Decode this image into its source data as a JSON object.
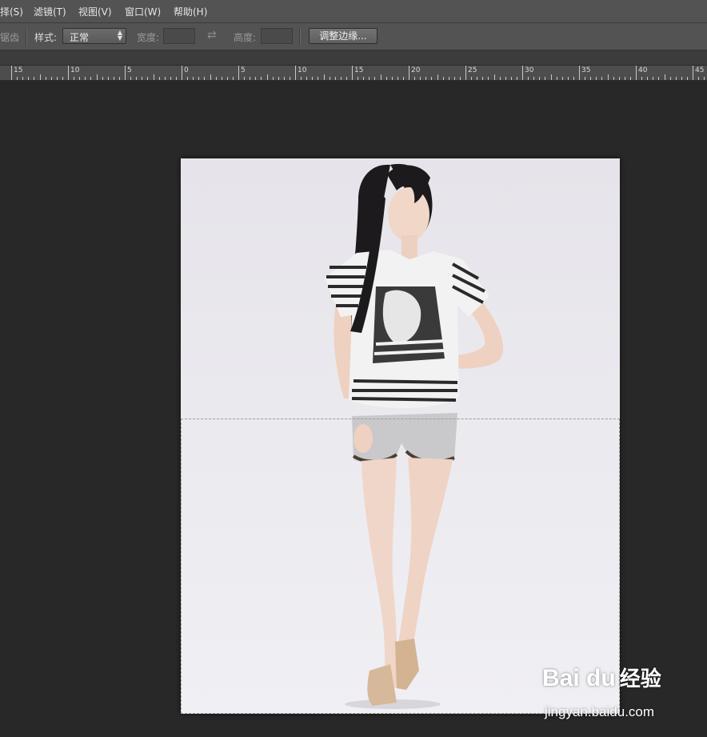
{
  "menu": {
    "items": [
      {
        "label": "择(S)"
      },
      {
        "label": "滤镜(T)"
      },
      {
        "label": "视图(V)"
      },
      {
        "label": "窗口(W)"
      },
      {
        "label": "帮助(H)"
      }
    ]
  },
  "options": {
    "antialias_label": "锯齿",
    "style_label": "样式:",
    "style_value": "正常",
    "width_label": "宽度:",
    "width_value": "",
    "height_label": "高度:",
    "height_value": "",
    "refine_edge_label": "调整边缘..."
  },
  "ruler": {
    "labels": [
      "15",
      "10",
      "5",
      "0",
      "5",
      "10",
      "15",
      "20",
      "25",
      "30",
      "35",
      "40",
      "45"
    ]
  },
  "watermark": {
    "logo": "Bai du",
    "text": "经验",
    "url": "jingyan.baidu.com"
  }
}
